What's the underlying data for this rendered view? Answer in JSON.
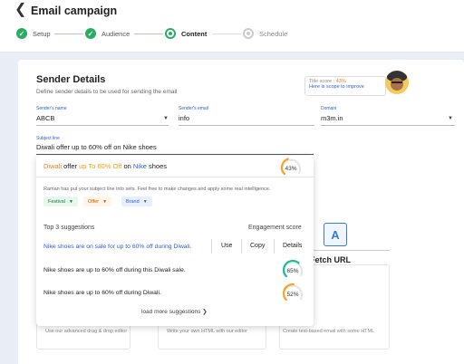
{
  "header": {
    "back_icon": "chevron-left-icon",
    "title": "Email campaign"
  },
  "steps": [
    {
      "label": "Setup",
      "state": "done"
    },
    {
      "label": "Audience",
      "state": "done"
    },
    {
      "label": "Content",
      "state": "active"
    },
    {
      "label": "Schedule",
      "state": "pending"
    }
  ],
  "sender": {
    "title": "Sender Details",
    "subtitle": "Define sender details to be used for sending the email",
    "name_label": "Sender's name",
    "name_value": "ABCB",
    "email_label": "Sender's email",
    "email_value": "info",
    "domain_label": "Domain",
    "domain_value": "m3m.in",
    "subject_label": "Subject line",
    "subject_value": "Diwali offer up to 60% off on Nike shoes"
  },
  "title_score": {
    "label": "Title score :",
    "value": "43%",
    "hint": "Here is scope to improve"
  },
  "panel": {
    "subject_words": {
      "w1": "Diwali",
      "w2": "offer",
      "w3": "up To 60% Off",
      "w4": "on",
      "w5": "Nike",
      "w6": "shoes"
    },
    "score": "43%",
    "score_fraction": 0.43,
    "note": "Raman has put your subject line into sets. Feel free to make changes and apply some real intelligence.",
    "chips": [
      "Festival",
      "Offer",
      "Brand"
    ],
    "suggestions_title": "Top 3 suggestions",
    "engagement_title": "Engagement score",
    "suggestions": [
      {
        "text": "Nike shoes are on sale for up to 60% off during Diwali.",
        "score": ""
      },
      {
        "text": "Nike shoes are up to 60% off during this Diwali sale.",
        "score": "65%",
        "score_fraction": 0.65
      },
      {
        "text": "Nike shoes are up to 60% off during Diwali.",
        "score": "52%",
        "score_fraction": 0.52
      }
    ],
    "actions": {
      "use": "Use",
      "copy": "Copy",
      "details": "Details"
    },
    "load_more": "load more suggestions"
  },
  "editors": {
    "drag_drop_desc": "Use our advanced drag & drop editor",
    "html_desc": "Write your own HTML with our editor",
    "fetch_label": "Fetch URL",
    "fetch_desc": "Create text-based email with some HTML"
  },
  "colors": {
    "accent": "#27ae60",
    "link": "#2b5fd9",
    "orange": "#e67e22",
    "gauge_green": "#1abc9c",
    "gauge_orange": "#f5a623"
  }
}
